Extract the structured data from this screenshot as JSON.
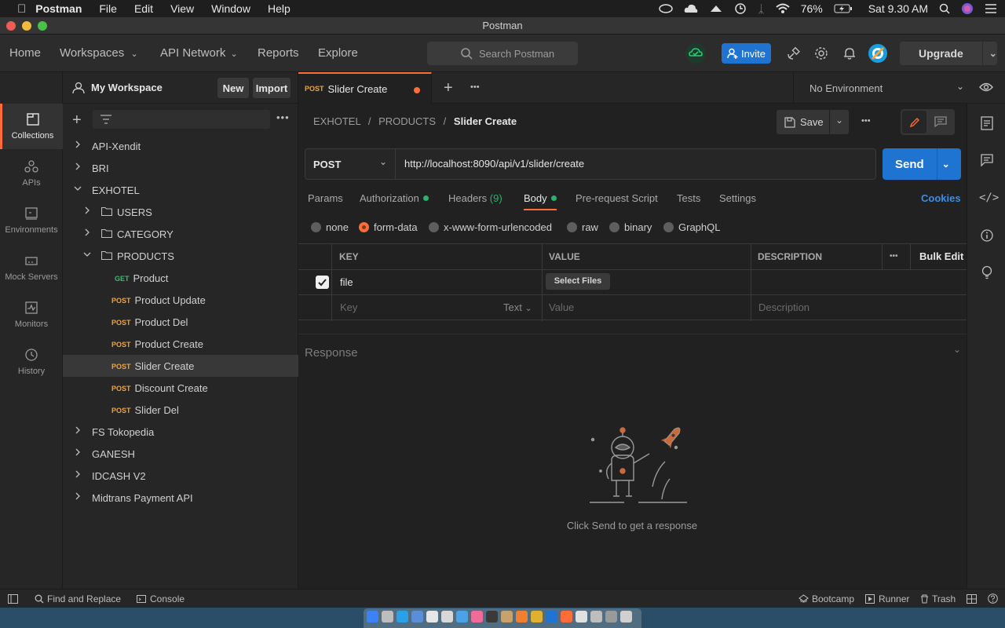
{
  "menubar": {
    "app": "Postman",
    "items": [
      "File",
      "Edit",
      "View",
      "Window",
      "Help"
    ],
    "battery": "76%",
    "clock": "Sat 9.30 AM"
  },
  "window": {
    "title": "Postman"
  },
  "header": {
    "nav": [
      "Home",
      "Workspaces",
      "API Network",
      "Reports",
      "Explore"
    ],
    "search_placeholder": "Search Postman",
    "invite": "Invite",
    "upgrade": "Upgrade"
  },
  "rail": [
    "Collections",
    "APIs",
    "Environments",
    "Mock Servers",
    "Monitors",
    "History"
  ],
  "sidebar": {
    "workspace": "My Workspace",
    "new": "New",
    "import": "Import",
    "tree": [
      {
        "label": "API-Xendit",
        "level": 0,
        "type": "collection",
        "expanded": false
      },
      {
        "label": "BRI",
        "level": 0,
        "type": "collection",
        "expanded": false
      },
      {
        "label": "EXHOTEL",
        "level": 0,
        "type": "collection",
        "expanded": true
      },
      {
        "label": "USERS",
        "level": 1,
        "type": "folder",
        "expanded": false
      },
      {
        "label": "CATEGORY",
        "level": 1,
        "type": "folder",
        "expanded": false
      },
      {
        "label": "PRODUCTS",
        "level": 1,
        "type": "folder",
        "expanded": true
      },
      {
        "label": "Product",
        "level": 2,
        "type": "request",
        "method": "GET"
      },
      {
        "label": "Product Update",
        "level": 2,
        "type": "request",
        "method": "POST"
      },
      {
        "label": "Product Del",
        "level": 2,
        "type": "request",
        "method": "POST"
      },
      {
        "label": "Product Create",
        "level": 2,
        "type": "request",
        "method": "POST"
      },
      {
        "label": "Slider Create",
        "level": 2,
        "type": "request",
        "method": "POST",
        "selected": true
      },
      {
        "label": "Discount Create",
        "level": 2,
        "type": "request",
        "method": "POST"
      },
      {
        "label": "Slider Del",
        "level": 2,
        "type": "request",
        "method": "POST"
      },
      {
        "label": "FS Tokopedia",
        "level": 0,
        "type": "collection",
        "expanded": false
      },
      {
        "label": "GANESH",
        "level": 0,
        "type": "collection",
        "expanded": false
      },
      {
        "label": "IDCASH V2",
        "level": 0,
        "type": "collection",
        "expanded": false
      },
      {
        "label": "Midtrans Payment API",
        "level": 0,
        "type": "collection",
        "expanded": false
      }
    ]
  },
  "tab": {
    "method": "POST",
    "name": "Slider Create"
  },
  "environment": "No Environment",
  "request": {
    "crumb": [
      "EXHOTEL",
      "PRODUCTS",
      "Slider Create"
    ],
    "save": "Save",
    "method": "POST",
    "url": "http://localhost:8090/api/v1/slider/create",
    "send": "Send",
    "tabs": [
      "Params",
      "Authorization",
      "Headers",
      "Body",
      "Pre-request Script",
      "Tests",
      "Settings"
    ],
    "headers_count": "(9)",
    "cookies": "Cookies",
    "body_types": [
      "none",
      "form-data",
      "x-www-form-urlencoded",
      "raw",
      "binary",
      "GraphQL"
    ],
    "table": {
      "cols": [
        "KEY",
        "VALUE",
        "DESCRIPTION"
      ],
      "bulk_edit": "Bulk Edit",
      "row_key": "file",
      "row_value_button": "Select Files",
      "key_ph": "Key",
      "type_ph": "Text",
      "value_ph": "Value",
      "desc_ph": "Description"
    }
  },
  "response": {
    "title": "Response",
    "empty": "Click Send to get a response"
  },
  "statusbar": {
    "find": "Find and Replace",
    "console": "Console",
    "bootcamp": "Bootcamp",
    "runner": "Runner",
    "trash": "Trash"
  },
  "colors": {
    "accent": "#ff6c37",
    "primary": "#1f73d1",
    "get": "#39b978",
    "post": "#f0a43a",
    "dot": "#29b36d"
  }
}
